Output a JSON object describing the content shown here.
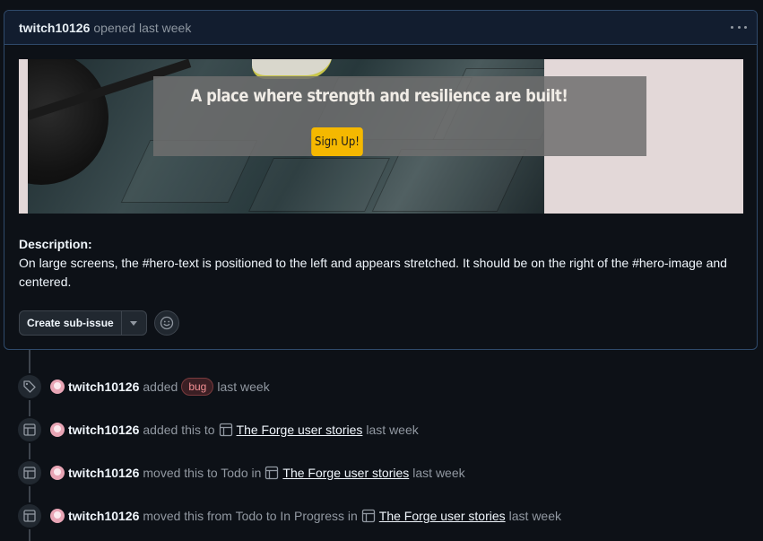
{
  "header": {
    "author": "twitch10126",
    "meta": "opened last week"
  },
  "hero": {
    "headline": "A place where strength and resilience are built!",
    "button_label": "Sign Up!"
  },
  "description": {
    "title": "Description:",
    "body": "On large screens, the #hero-text is positioned to the left and appears stretched. It should be on the right of the #hero-image and centered."
  },
  "actions": {
    "create_sub_issue": "Create sub-issue"
  },
  "timeline": [
    {
      "icon": "tag-icon",
      "actor": "twitch10126",
      "text1": "added",
      "label": "bug",
      "time": "last week"
    },
    {
      "icon": "project-table-icon",
      "actor": "twitch10126",
      "text1": "added this to",
      "project": "The Forge user stories",
      "time": "last week"
    },
    {
      "icon": "project-table-icon",
      "actor": "twitch10126",
      "text1": "moved this to Todo in",
      "project": "The Forge user stories",
      "time": "last week"
    },
    {
      "icon": "project-table-icon",
      "actor": "twitch10126",
      "text1": "moved this from Todo to In Progress in",
      "project": "The Forge user stories",
      "time": "last week"
    }
  ],
  "colors": {
    "background": "#0d1117",
    "border_accent": "#2f4a6b",
    "bug_label": "#f28f93",
    "signup_button": "#f5b800"
  }
}
